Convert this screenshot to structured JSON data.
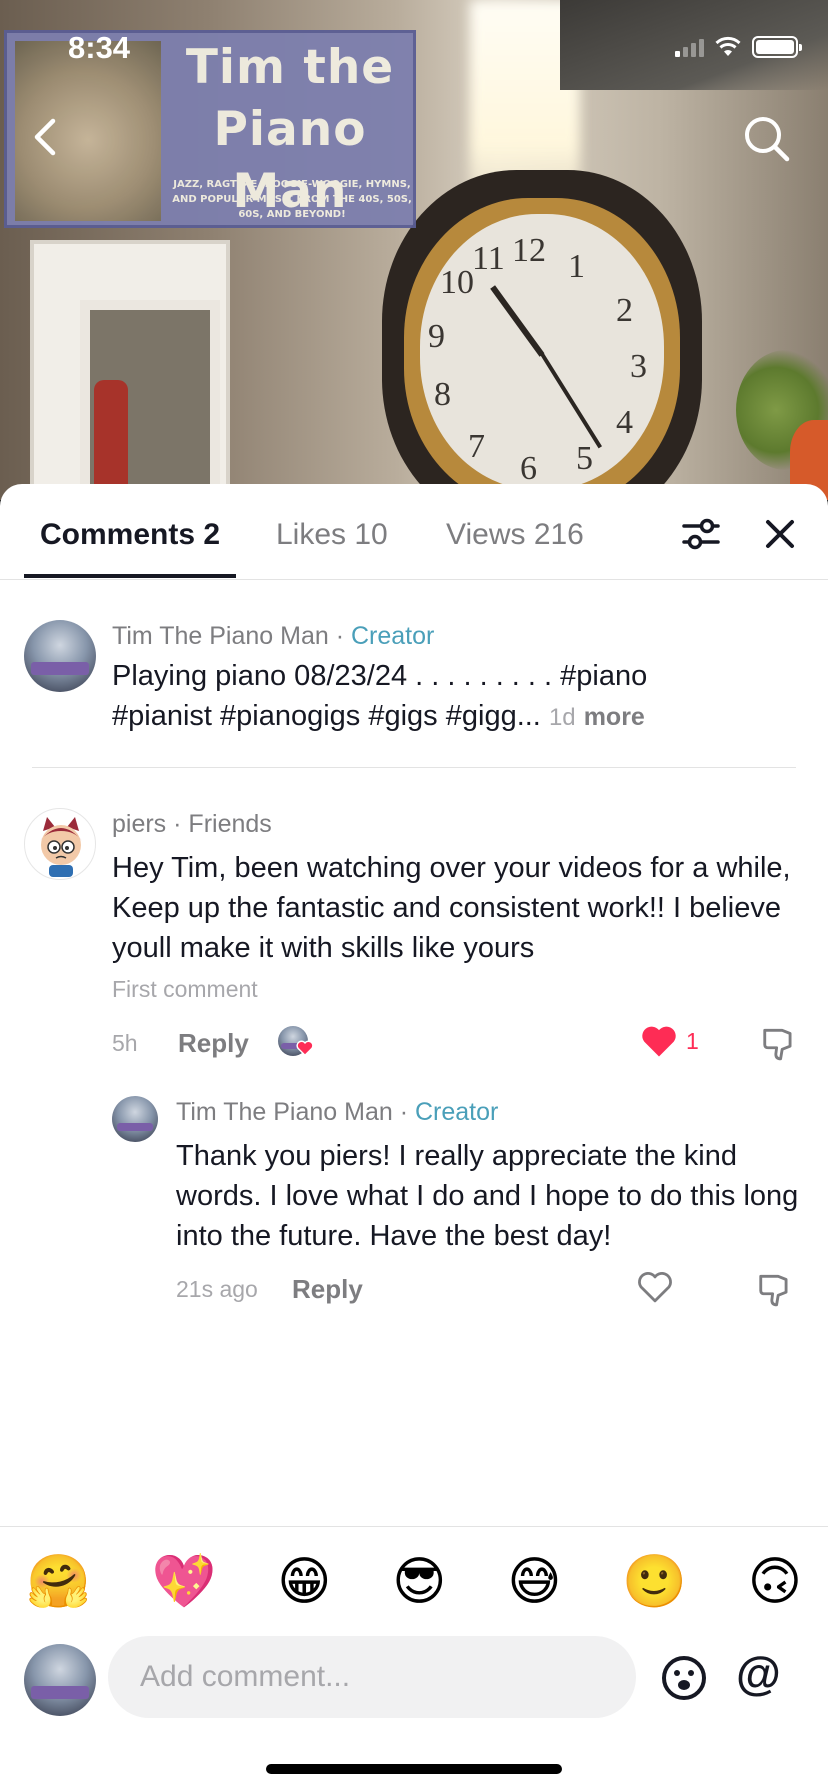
{
  "status_bar": {
    "time": "8:34"
  },
  "video": {
    "banner": {
      "title_line1": "Tim the",
      "title_line2": "Piano Man",
      "subtitle": "JAZZ, RAGTIME, BOOGIE-WOOGIE, HYMNS, AND POPULAR MUSIC FROM THE 40S, 50S, 60S, AND BEYOND!"
    },
    "icons": {
      "back": "chevron-left-icon",
      "search": "search-icon"
    }
  },
  "tabs": [
    {
      "label": "Comments 2",
      "active": true
    },
    {
      "label": "Likes 10",
      "active": false
    },
    {
      "label": "Views 216",
      "active": false
    }
  ],
  "header_icons": {
    "filter": "sliders-icon",
    "close": "close-icon"
  },
  "caption": {
    "author": "Tim The Piano Man",
    "separator": "·",
    "badge": "Creator",
    "text_line1": "Playing piano 08/23/24 . . . . . . . . . #piano",
    "text_line2": "#pianist #pianogigs #gigs #gigg...",
    "age": "1d",
    "more_label": "more"
  },
  "comments": [
    {
      "author": "piers",
      "separator": "·",
      "relation": "Friends",
      "text": "Hey Tim, been watching over your videos for a while, Keep up the fantastic and consistent work!! I believe youll make it with skills like yours",
      "note": "First comment",
      "age": "5h",
      "reply_label": "Reply",
      "liked": true,
      "like_count": "1",
      "replies": [
        {
          "author": "Tim The Piano Man",
          "separator": "·",
          "badge": "Creator",
          "text": "Thank you piers! I really appreciate the kind words. I love what I do and I hope to do this long into the future. Have the best day!",
          "age": "21s ago",
          "reply_label": "Reply",
          "liked": false
        }
      ]
    }
  ],
  "quick_emojis": [
    "🤗",
    "💖",
    "😁",
    "😎",
    "😅",
    "🙂",
    "🙃"
  ],
  "composer": {
    "placeholder": "Add comment...",
    "mention_label": "@",
    "icons": {
      "emoji_picker": "emoji-face-icon"
    }
  },
  "colors": {
    "accent_creator": "#4a9fb9",
    "like_red": "#fe2c55",
    "text_primary": "#161823",
    "text_secondary": "#7d7d80"
  }
}
